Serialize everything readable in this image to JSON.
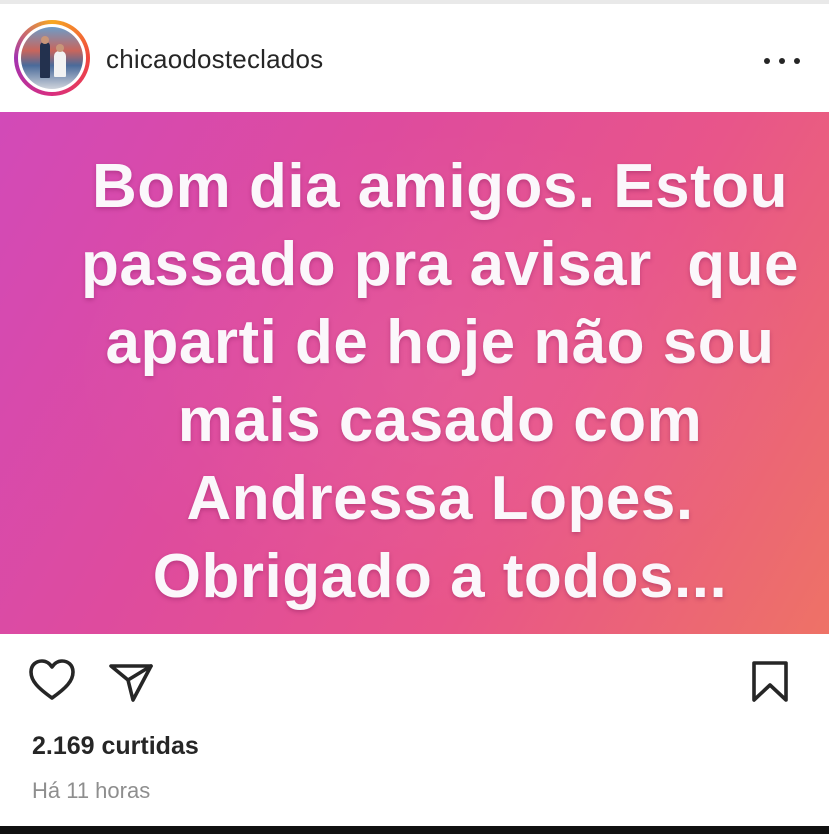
{
  "post": {
    "username": "chicaodosteclados",
    "more_icon": "more-horizontal-icon",
    "image_text_lines": [
      "Bom dia amigos. Estou",
      "passado pra avisar  que",
      "aparti de hoje não sou",
      "mais casado com",
      "Andressa Lopes.",
      "Obrigado a todos..."
    ],
    "image_gradient": [
      "#d24ab8",
      "#e8558a",
      "#ee7266"
    ]
  },
  "actions": {
    "like_icon": "heart-icon",
    "share_icon": "paper-plane-icon",
    "save_icon": "bookmark-icon"
  },
  "likes_text": "2.169 curtidas",
  "time_text": "Há 11 horas"
}
